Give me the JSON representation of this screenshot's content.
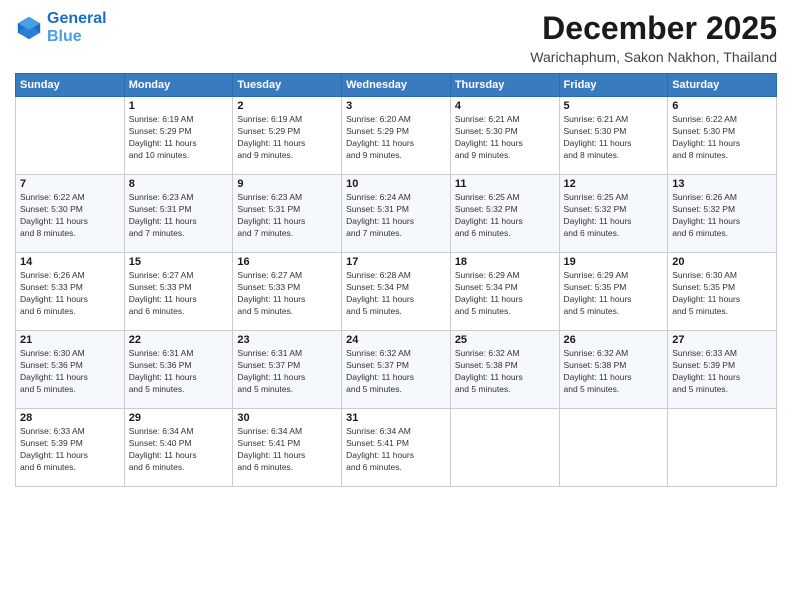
{
  "header": {
    "logo_line1": "General",
    "logo_line2": "Blue",
    "month": "December 2025",
    "location": "Warichaphum, Sakon Nakhon, Thailand"
  },
  "days_of_week": [
    "Sunday",
    "Monday",
    "Tuesday",
    "Wednesday",
    "Thursday",
    "Friday",
    "Saturday"
  ],
  "weeks": [
    [
      {
        "day": "",
        "info": ""
      },
      {
        "day": "1",
        "info": "Sunrise: 6:19 AM\nSunset: 5:29 PM\nDaylight: 11 hours\nand 10 minutes."
      },
      {
        "day": "2",
        "info": "Sunrise: 6:19 AM\nSunset: 5:29 PM\nDaylight: 11 hours\nand 9 minutes."
      },
      {
        "day": "3",
        "info": "Sunrise: 6:20 AM\nSunset: 5:29 PM\nDaylight: 11 hours\nand 9 minutes."
      },
      {
        "day": "4",
        "info": "Sunrise: 6:21 AM\nSunset: 5:30 PM\nDaylight: 11 hours\nand 9 minutes."
      },
      {
        "day": "5",
        "info": "Sunrise: 6:21 AM\nSunset: 5:30 PM\nDaylight: 11 hours\nand 8 minutes."
      },
      {
        "day": "6",
        "info": "Sunrise: 6:22 AM\nSunset: 5:30 PM\nDaylight: 11 hours\nand 8 minutes."
      }
    ],
    [
      {
        "day": "7",
        "info": "Sunrise: 6:22 AM\nSunset: 5:30 PM\nDaylight: 11 hours\nand 8 minutes."
      },
      {
        "day": "8",
        "info": "Sunrise: 6:23 AM\nSunset: 5:31 PM\nDaylight: 11 hours\nand 7 minutes."
      },
      {
        "day": "9",
        "info": "Sunrise: 6:23 AM\nSunset: 5:31 PM\nDaylight: 11 hours\nand 7 minutes."
      },
      {
        "day": "10",
        "info": "Sunrise: 6:24 AM\nSunset: 5:31 PM\nDaylight: 11 hours\nand 7 minutes."
      },
      {
        "day": "11",
        "info": "Sunrise: 6:25 AM\nSunset: 5:32 PM\nDaylight: 11 hours\nand 6 minutes."
      },
      {
        "day": "12",
        "info": "Sunrise: 6:25 AM\nSunset: 5:32 PM\nDaylight: 11 hours\nand 6 minutes."
      },
      {
        "day": "13",
        "info": "Sunrise: 6:26 AM\nSunset: 5:32 PM\nDaylight: 11 hours\nand 6 minutes."
      }
    ],
    [
      {
        "day": "14",
        "info": "Sunrise: 6:26 AM\nSunset: 5:33 PM\nDaylight: 11 hours\nand 6 minutes."
      },
      {
        "day": "15",
        "info": "Sunrise: 6:27 AM\nSunset: 5:33 PM\nDaylight: 11 hours\nand 6 minutes."
      },
      {
        "day": "16",
        "info": "Sunrise: 6:27 AM\nSunset: 5:33 PM\nDaylight: 11 hours\nand 5 minutes."
      },
      {
        "day": "17",
        "info": "Sunrise: 6:28 AM\nSunset: 5:34 PM\nDaylight: 11 hours\nand 5 minutes."
      },
      {
        "day": "18",
        "info": "Sunrise: 6:29 AM\nSunset: 5:34 PM\nDaylight: 11 hours\nand 5 minutes."
      },
      {
        "day": "19",
        "info": "Sunrise: 6:29 AM\nSunset: 5:35 PM\nDaylight: 11 hours\nand 5 minutes."
      },
      {
        "day": "20",
        "info": "Sunrise: 6:30 AM\nSunset: 5:35 PM\nDaylight: 11 hours\nand 5 minutes."
      }
    ],
    [
      {
        "day": "21",
        "info": "Sunrise: 6:30 AM\nSunset: 5:36 PM\nDaylight: 11 hours\nand 5 minutes."
      },
      {
        "day": "22",
        "info": "Sunrise: 6:31 AM\nSunset: 5:36 PM\nDaylight: 11 hours\nand 5 minutes."
      },
      {
        "day": "23",
        "info": "Sunrise: 6:31 AM\nSunset: 5:37 PM\nDaylight: 11 hours\nand 5 minutes."
      },
      {
        "day": "24",
        "info": "Sunrise: 6:32 AM\nSunset: 5:37 PM\nDaylight: 11 hours\nand 5 minutes."
      },
      {
        "day": "25",
        "info": "Sunrise: 6:32 AM\nSunset: 5:38 PM\nDaylight: 11 hours\nand 5 minutes."
      },
      {
        "day": "26",
        "info": "Sunrise: 6:32 AM\nSunset: 5:38 PM\nDaylight: 11 hours\nand 5 minutes."
      },
      {
        "day": "27",
        "info": "Sunrise: 6:33 AM\nSunset: 5:39 PM\nDaylight: 11 hours\nand 5 minutes."
      }
    ],
    [
      {
        "day": "28",
        "info": "Sunrise: 6:33 AM\nSunset: 5:39 PM\nDaylight: 11 hours\nand 6 minutes."
      },
      {
        "day": "29",
        "info": "Sunrise: 6:34 AM\nSunset: 5:40 PM\nDaylight: 11 hours\nand 6 minutes."
      },
      {
        "day": "30",
        "info": "Sunrise: 6:34 AM\nSunset: 5:41 PM\nDaylight: 11 hours\nand 6 minutes."
      },
      {
        "day": "31",
        "info": "Sunrise: 6:34 AM\nSunset: 5:41 PM\nDaylight: 11 hours\nand 6 minutes."
      },
      {
        "day": "",
        "info": ""
      },
      {
        "day": "",
        "info": ""
      },
      {
        "day": "",
        "info": ""
      }
    ]
  ]
}
